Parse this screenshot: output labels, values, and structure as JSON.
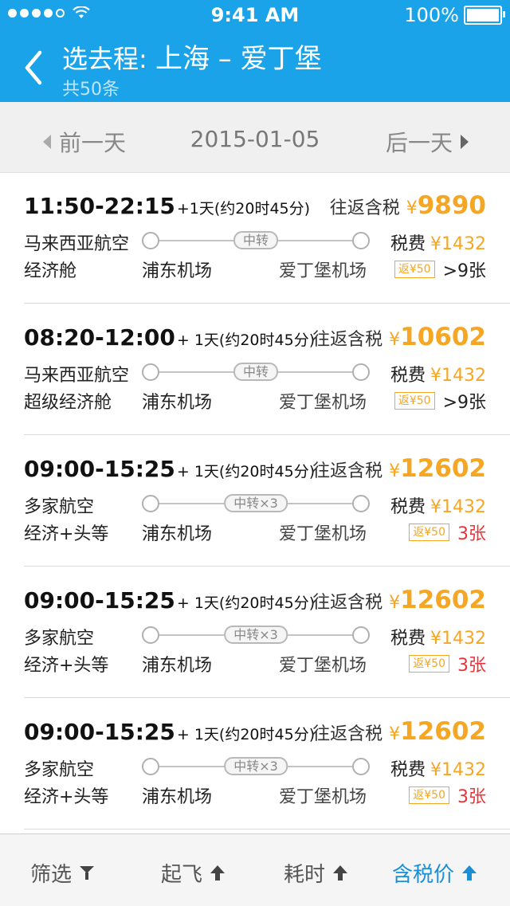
{
  "status": {
    "time": "9:41 AM",
    "battery": "100%"
  },
  "header": {
    "title_prefix": "选去程:",
    "route": "上海 – 爱丁堡",
    "subtitle": "共50条"
  },
  "datebar": {
    "prev_label": "前一天",
    "date": "2015-01-05",
    "next_label": "后一天"
  },
  "flights": [
    {
      "times": "11:50-22:15",
      "duration": "+1天(约20时45分)",
      "price_label": "往返含税",
      "currency": "¥",
      "price": "9890",
      "airline": "马来西亚航空",
      "stop": "中转",
      "tax_label": "税费",
      "tax": "¥1432",
      "cabin": "经济舱",
      "from": "浦东机场",
      "to": "爱丁堡机场",
      "rebate": "返¥50",
      "seats": ">9张"
    },
    {
      "times": "08:20-12:00",
      "duration": "+ 1天(约20时45分)",
      "price_label": "往返含税",
      "currency": "¥",
      "price": "10602",
      "airline": "马来西亚航空",
      "stop": "中转",
      "tax_label": "税费",
      "tax": "¥1432",
      "cabin": "超级经济舱",
      "from": "浦东机场",
      "to": "爱丁堡机场",
      "rebate": "返¥50",
      "seats": ">9张"
    },
    {
      "times": "09:00-15:25",
      "duration": "+ 1天(约20时45分)",
      "price_label": "往返含税",
      "currency": "¥",
      "price": "12602",
      "airline": "多家航空",
      "stop": "中转×3",
      "tax_label": "税费",
      "tax": "¥1432",
      "cabin": "经济+头等",
      "from": "浦东机场",
      "to": "爱丁堡机场",
      "rebate": "返¥50",
      "seats": "3张"
    },
    {
      "times": "09:00-15:25",
      "duration": "+ 1天(约20时45分)",
      "price_label": "往返含税",
      "currency": "¥",
      "price": "12602",
      "airline": "多家航空",
      "stop": "中转×3",
      "tax_label": "税费",
      "tax": "¥1432",
      "cabin": "经济+头等",
      "from": "浦东机场",
      "to": "爱丁堡机场",
      "rebate": "返¥50",
      "seats": "3张"
    },
    {
      "times": "09:00-15:25",
      "duration": "+ 1天(约20时45分)",
      "price_label": "往返含税",
      "currency": "¥",
      "price": "12602",
      "airline": "多家航空",
      "stop": "中转×3",
      "tax_label": "税费",
      "tax": "¥1432",
      "cabin": "经济+头等",
      "from": "浦东机场",
      "to": "爱丁堡机场",
      "rebate": "返¥50",
      "seats": "3张"
    }
  ],
  "bottom": {
    "filter": "筛选",
    "depart": "起飞",
    "duration": "耗时",
    "price": "含税价"
  },
  "colors": {
    "header": "#1aa3e8",
    "price": "#f5a623",
    "seats_low": "#e8343a",
    "active_sort": "#1a8fd6"
  }
}
